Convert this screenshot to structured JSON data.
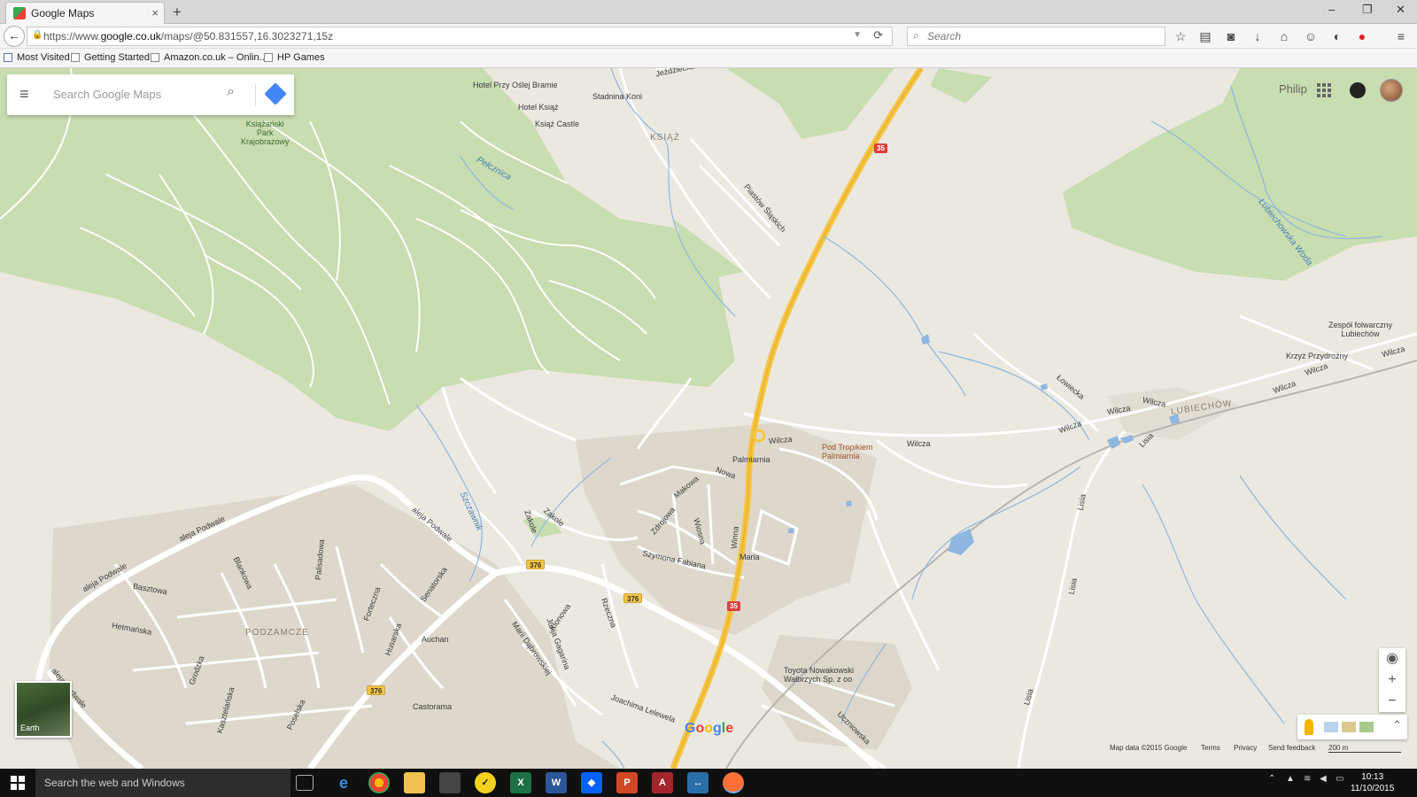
{
  "browser": {
    "tab_title": "Google Maps",
    "new_tab_label": "+",
    "tab_close": "×",
    "url_prefix": "https://www.",
    "url_domain": "google.co.uk",
    "url_path": "/maps/@50.831557,16.3023271,15z",
    "search_placeholder": "Search",
    "window_controls": [
      "–",
      "❐",
      "✕"
    ]
  },
  "bookmarks": [
    "Most Visited",
    "Getting Started",
    "Amazon.co.uk – Onlin...",
    "HP Games"
  ],
  "maps": {
    "search_placeholder": "Search Google Maps",
    "user_name": "Philip",
    "earth_label": "Earth",
    "google_logo": [
      "G",
      "o",
      "o",
      "g",
      "l",
      "e"
    ],
    "logo_colors": [
      "#4285f4",
      "#ea4335",
      "#fbbc05",
      "#4285f4",
      "#34a853",
      "#ea4335"
    ],
    "footer": {
      "map_data": "Map data ©2015 Google",
      "terms": "Terms",
      "privacy": "Privacy",
      "feedback": "Send feedback",
      "scale": "200 m"
    },
    "labels": {
      "hotel_przy": "Hotel Przy Oślej Bramie",
      "stadnina": "Stadnina Koni",
      "hotel_ksiaz": "Hotel Książ",
      "ksiaz_castle": "Książ Castle",
      "ksiaz": "KSIĄŻ",
      "park": [
        "Książański",
        "Park",
        "Krajobrazowy"
      ],
      "pelcznica": "Pełcznica",
      "piastow": "Piastów Śląskich",
      "jezdziecka": "Jeździecka",
      "lubiechowska": "Lubiechowska Woda",
      "zespol": [
        "Zespół folwarczny",
        "Lubiechów"
      ],
      "krzyz": "Krzyż Przydrożny",
      "lubiechow": "LUBIECHÓW",
      "wilcza": "Wilcza",
      "lowiecka": "Łowiecka",
      "lisia": "Lisia",
      "pod_tropikiem": [
        "Pod Tropikiem",
        "Palmiarnia"
      ],
      "palmiarnia": "Palmiarnia",
      "nowa": "Nowa",
      "makowa": "Makowa",
      "zdrojowa": "Zdrojowa",
      "wiosna": "Wiosna",
      "winna": "Winna",
      "szymona": "Szymona Fabiana",
      "maria": "Maria",
      "zakole": "Zakole",
      "szczawnik": "Szczawnik",
      "aleja_podwale": "aleja Podwale",
      "podzamcze": "PODZAMCZE",
      "auchan": "Auchan",
      "castorama": "Castorama",
      "toyota": [
        "Toyota Nowakowski",
        "Wałbrzych Sp. z oo"
      ],
      "joachima": "Joachima Lelewela",
      "uczniowska": "Uczniowska",
      "senatorska": "Senatorska",
      "palisadowa": "Palisadowa",
      "forteczna": "Forteczna",
      "husarska": "Husarska",
      "hetmanska": "Hetmańska",
      "bastowa": "Basztowa",
      "blankowa": "Blankowa",
      "grodzka": "Grodzka",
      "kasztelanska": "Kasztelańska",
      "poselska": "Poselska",
      "klonowa": "Klonowa",
      "jurija": "Jurija Gagarina",
      "marii": "Marii Dąbrowskiej",
      "rzeczna": "Rzeczna"
    },
    "road_shields": [
      "35",
      "35",
      "376",
      "376",
      "376"
    ]
  },
  "taskbar": {
    "search_placeholder": "Search the web and Windows",
    "time": "10:13",
    "date": "11/10/2015"
  }
}
